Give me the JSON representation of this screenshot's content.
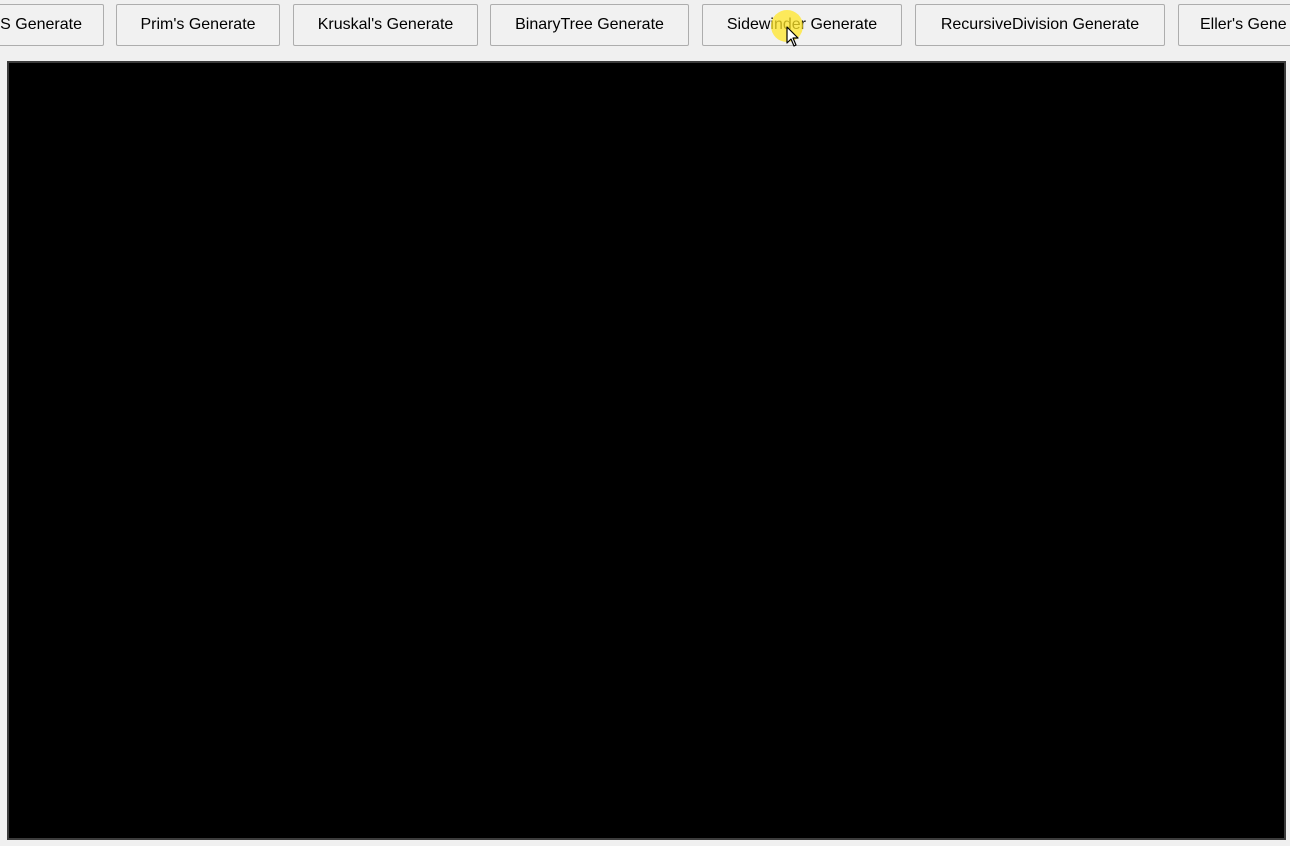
{
  "toolbar": {
    "buttons": [
      {
        "label": "S Generate"
      },
      {
        "label": "Prim's Generate"
      },
      {
        "label": "Kruskal's Generate"
      },
      {
        "label": "BinaryTree Generate"
      },
      {
        "label": "Sidewinder Generate"
      },
      {
        "label": "RecursiveDivision Generate"
      },
      {
        "label": "Eller's Gene"
      }
    ]
  },
  "canvas": {
    "background_color": "#000000"
  },
  "cursor": {
    "icon": "mouse-pointer-icon",
    "highlight_color": "#ffe628"
  }
}
